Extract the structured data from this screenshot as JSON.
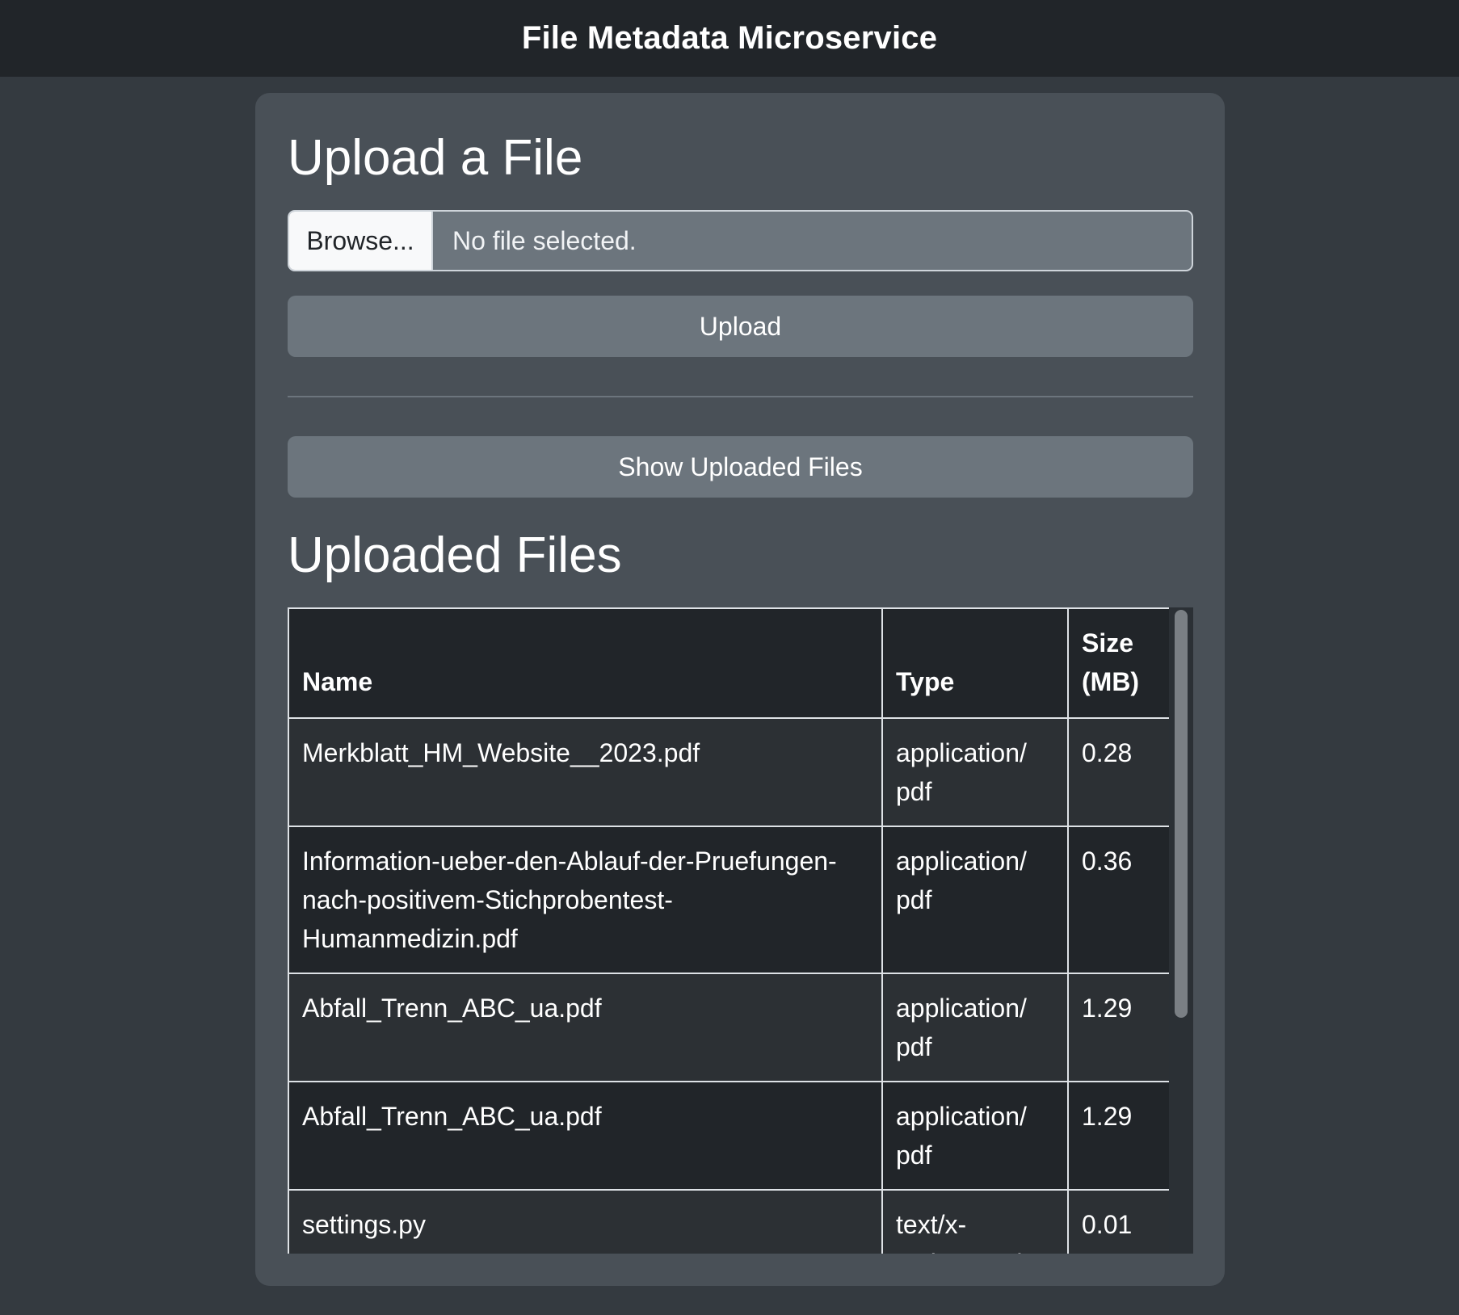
{
  "header": {
    "title": "File Metadata Microservice"
  },
  "upload": {
    "heading": "Upload a File",
    "browse_label": "Browse...",
    "file_status": "No file selected.",
    "upload_button": "Upload"
  },
  "show_button": "Show Uploaded Files",
  "files": {
    "heading": "Uploaded Files",
    "columns": [
      "Name",
      "Type",
      "Size (MB)"
    ],
    "rows": [
      {
        "name": "Merkblatt_HM_Website__2023.pdf",
        "type": "application/ pdf",
        "size": "0.28"
      },
      {
        "name": "Information-ueber-den-Ablauf-der-Pruefungen-nach-positivem-Stichprobentest-Humanmedizin.pdf",
        "type": "application/ pdf",
        "size": "0.36"
      },
      {
        "name": "Abfall_Trenn_ABC_ua.pdf",
        "type": "application/ pdf",
        "size": "1.29"
      },
      {
        "name": "Abfall_Trenn_ABC_ua.pdf",
        "type": "application/ pdf",
        "size": "1.29"
      },
      {
        "name": "settings.py",
        "type": "text/x- python-script",
        "size": "0.01"
      }
    ]
  }
}
